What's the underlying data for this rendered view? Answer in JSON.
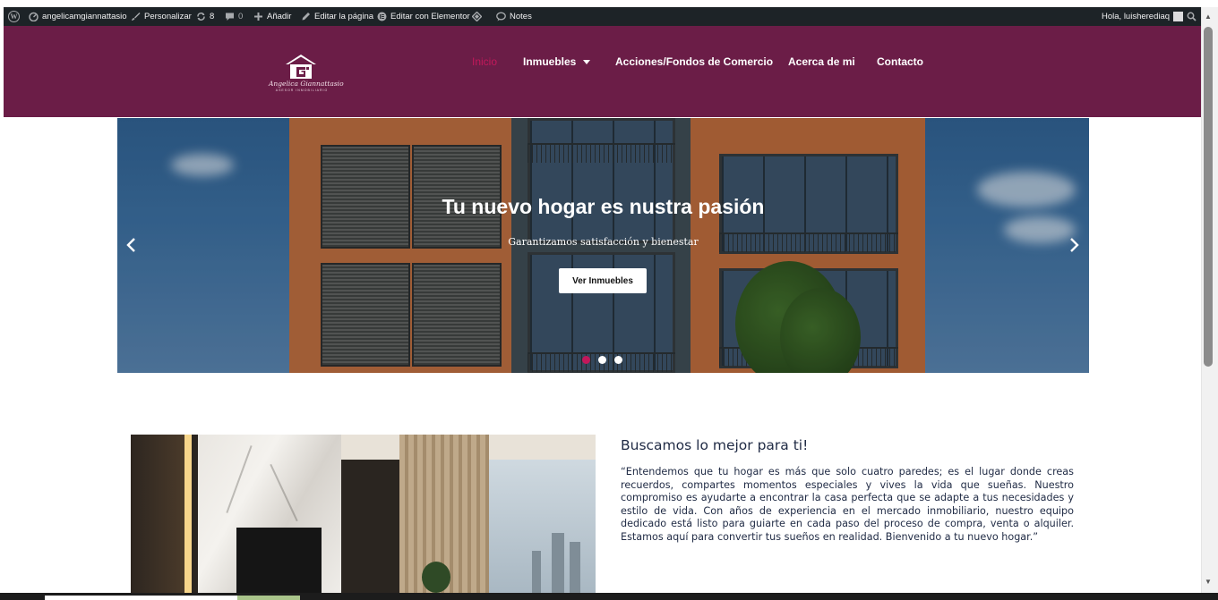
{
  "admin_bar": {
    "site_name": "angelicamgiannattasio",
    "customize": "Personalizar",
    "updates_count": "8",
    "comments_count": "0",
    "add_new": "Añadir",
    "edit_page": "Editar la página",
    "edit_elementor": "Editar con Elementor",
    "notes": "Notes",
    "greeting": "Hola, luisherediaq"
  },
  "header": {
    "logo_script": "Angelica Giannattasio",
    "logo_subtitle": "ASESOR INMOBILIARIO",
    "nav": [
      {
        "label": "Inicio",
        "active": true
      },
      {
        "label": "Inmuebles",
        "has_dropdown": true
      },
      {
        "label": "Acciones/Fondos de Comercio"
      },
      {
        "label": "Acerca de mi"
      },
      {
        "label": "Contacto"
      }
    ],
    "background_color": "#6b1d47",
    "active_color": "#c2185b"
  },
  "slider": {
    "title": "Tu nuevo hogar es nustra pasión",
    "subtitle": "Garantizamos satisfacción y bienestar",
    "button_label": "Ver Inmuebles",
    "prev_icon": "chevron-left-icon",
    "next_icon": "chevron-right-icon",
    "slides_count": 3,
    "active_slide": 1
  },
  "about": {
    "title": "Buscamos lo mejor para ti!",
    "text": "“Entendemos que tu hogar es más que solo cuatro paredes; es el lugar donde creas recuerdos, compartes momentos especiales y vives la vida que sueñas. Nuestro compromiso es ayudarte a encontrar la casa perfecta que se adapte a tus necesidades y estilo de vida. Con años de experiencia en el mercado inmobiliario, nuestro equipo dedicado está listo para guiarte en cada paso del proceso de compra, venta o alquiler. Estamos aquí para convertir tus sueños en realidad. Bienvenido a tu nuevo hogar.”"
  }
}
